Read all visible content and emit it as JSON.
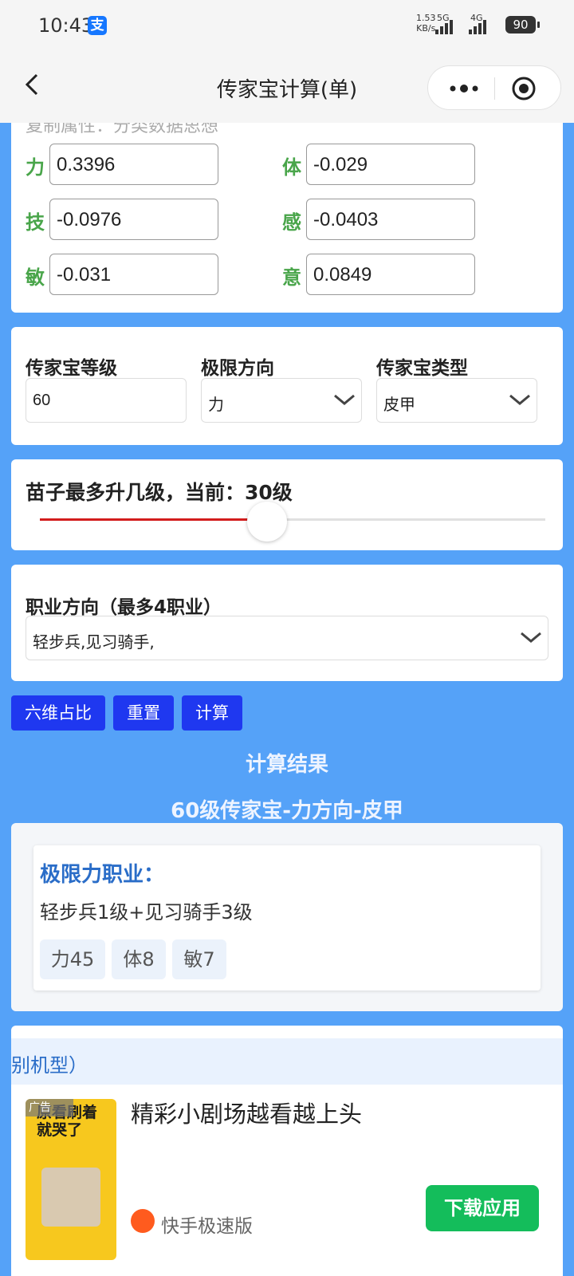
{
  "status": {
    "time": "10:43",
    "net_speed_top": "1.53",
    "net_speed_bottom": "KB/s",
    "net1": "5G",
    "net2": "4G",
    "battery": "90"
  },
  "nav": {
    "title": "传家宝计算(单)"
  },
  "weights": {
    "cut_text": "复制属性：分类数据思想",
    "items": [
      {
        "label": "力",
        "value": "0.3396"
      },
      {
        "label": "体",
        "value": "-0.029"
      },
      {
        "label": "技",
        "value": "-0.0976"
      },
      {
        "label": "感",
        "value": "-0.0403"
      },
      {
        "label": "敏",
        "value": "-0.031"
      },
      {
        "label": "意",
        "value": "0.0849"
      }
    ]
  },
  "settings": {
    "level_label": "传家宝等级",
    "level_value": "60",
    "direction_label": "极限方向",
    "direction_value": "力",
    "type_label": "传家宝类型",
    "type_value": "皮甲"
  },
  "slider": {
    "title": "苗子最多升几级，当前：30级",
    "fraction": 0.45
  },
  "career": {
    "label": "职业方向（最多4职业）",
    "value": "轻步兵,见习骑手,"
  },
  "buttons": {
    "ratio": "六维占比",
    "reset": "重置",
    "calc": "计算"
  },
  "result": {
    "title": "计算结果",
    "subtitle": "60级传家宝-力方向-皮甲",
    "card_title": "极限力职业：",
    "detail": "轻步兵1级+见习骑手3级",
    "chips": [
      "力45",
      "体8",
      "敏7"
    ]
  },
  "ad": {
    "hint": "别机型）",
    "tag": "广告",
    "thumb_line1": "原看刷着",
    "thumb_line2": "就哭了",
    "title": "精彩小剧场越看越上头",
    "brand": "快手极速版",
    "button": "下载应用"
  },
  "colors": {
    "accent_blue": "#1f38f0",
    "page_bg": "#55a2f8",
    "label_green": "#49a54a",
    "slider_red": "#d21d1d",
    "download_green": "#14bd5b"
  }
}
